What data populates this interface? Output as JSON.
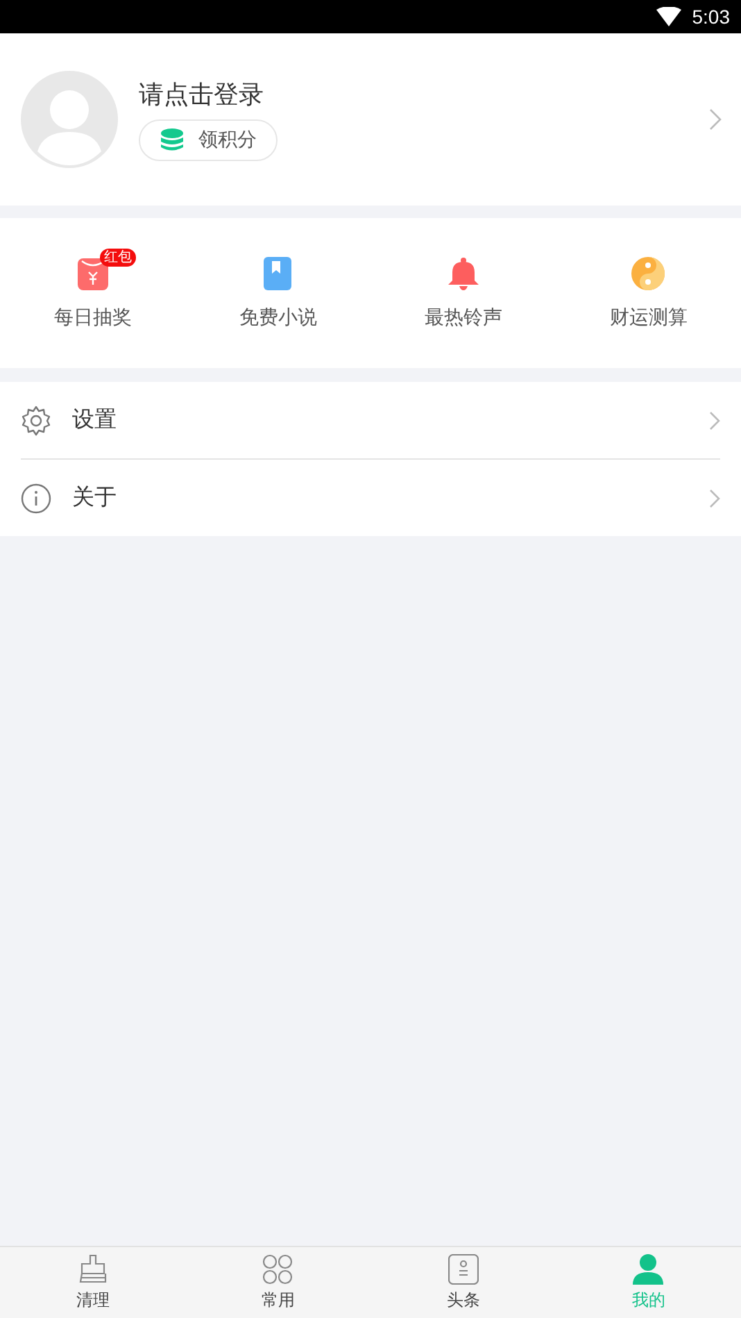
{
  "status_bar": {
    "time": "5:03"
  },
  "profile": {
    "login_prompt": "请点击登录",
    "points_button": "领积分"
  },
  "shortcuts": [
    {
      "kind": "redpacket",
      "label": "每日抽奖",
      "badge": "红包"
    },
    {
      "kind": "book",
      "label": "免费小说"
    },
    {
      "kind": "bell",
      "label": "最热铃声"
    },
    {
      "kind": "yinyang",
      "label": "财运测算"
    }
  ],
  "menu": [
    {
      "kind": "settings",
      "label": "设置"
    },
    {
      "kind": "info",
      "label": "关于"
    }
  ],
  "nav": [
    {
      "kind": "clean",
      "label": "清理",
      "selected": false
    },
    {
      "kind": "apps",
      "label": "常用",
      "selected": false
    },
    {
      "kind": "news",
      "label": "头条",
      "selected": false
    },
    {
      "kind": "me",
      "label": "我的",
      "selected": true
    }
  ]
}
